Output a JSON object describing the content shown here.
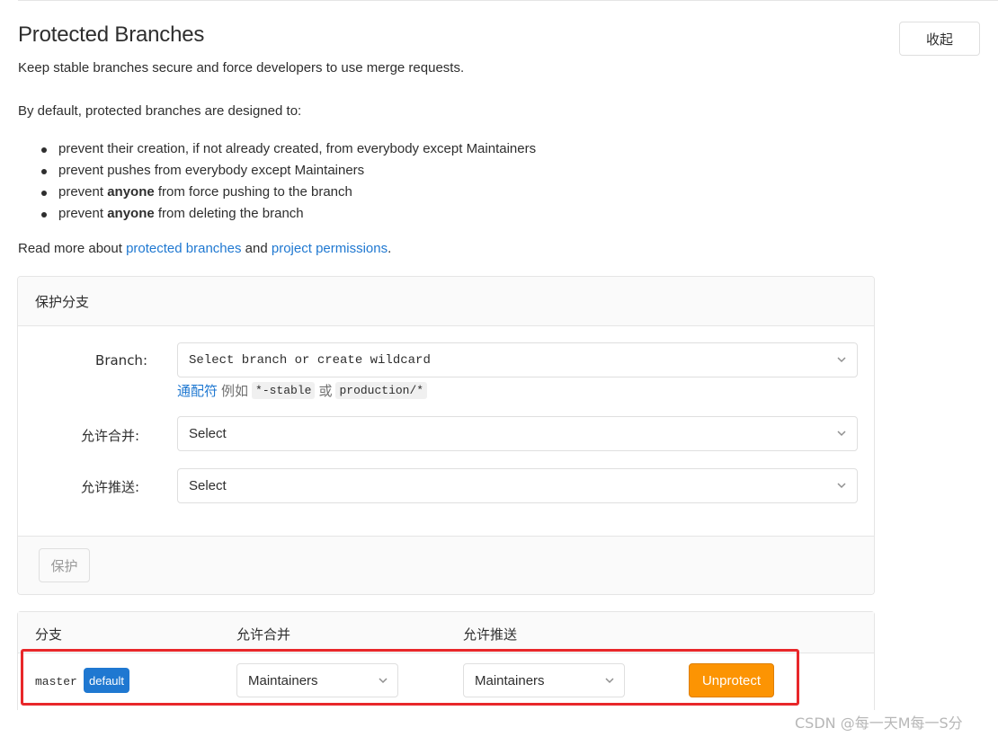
{
  "header": {
    "title": "Protected Branches",
    "collapse_label": "收起",
    "description": "Keep stable branches secure and force developers to use merge requests."
  },
  "intro": {
    "default_text": "By default, protected branches are designed to:",
    "bullets": [
      {
        "pre": "prevent their creation, if not already created, from everybody except Maintainers",
        "bold": "",
        "post": ""
      },
      {
        "pre": "prevent pushes from everybody except Maintainers",
        "bold": "",
        "post": ""
      },
      {
        "pre": "prevent ",
        "bold": "anyone",
        "post": " from force pushing to the branch"
      },
      {
        "pre": "prevent ",
        "bold": "anyone",
        "post": " from deleting the branch"
      }
    ],
    "read_more_prefix": "Read more about ",
    "link1": "protected branches",
    "and_text": " and ",
    "link2": "project permissions",
    "suffix": "."
  },
  "form": {
    "card_title": "保护分支",
    "branch_label": "Branch:",
    "branch_placeholder": "Select branch or create wildcard",
    "hint_link": "通配符",
    "hint_example": "例如",
    "hint_code1": "*-stable",
    "hint_or": "或",
    "hint_code2": "production/*",
    "merge_label": "允许合并:",
    "merge_value": "Select",
    "push_label": "允许推送:",
    "push_value": "Select",
    "protect_button": "保护"
  },
  "table": {
    "headers": [
      "分支",
      "允许合并",
      "允许推送"
    ],
    "rows": [
      {
        "branch": "master",
        "badge": "default",
        "merge": "Maintainers",
        "push": "Maintainers",
        "action": "Unprotect"
      }
    ]
  },
  "colors": {
    "link": "#1f78d1",
    "badge": "#1f78d1",
    "unprotect": "#fc9403",
    "highlight": "#e8272a"
  },
  "watermark": "CSDN @每一天M每一S分"
}
